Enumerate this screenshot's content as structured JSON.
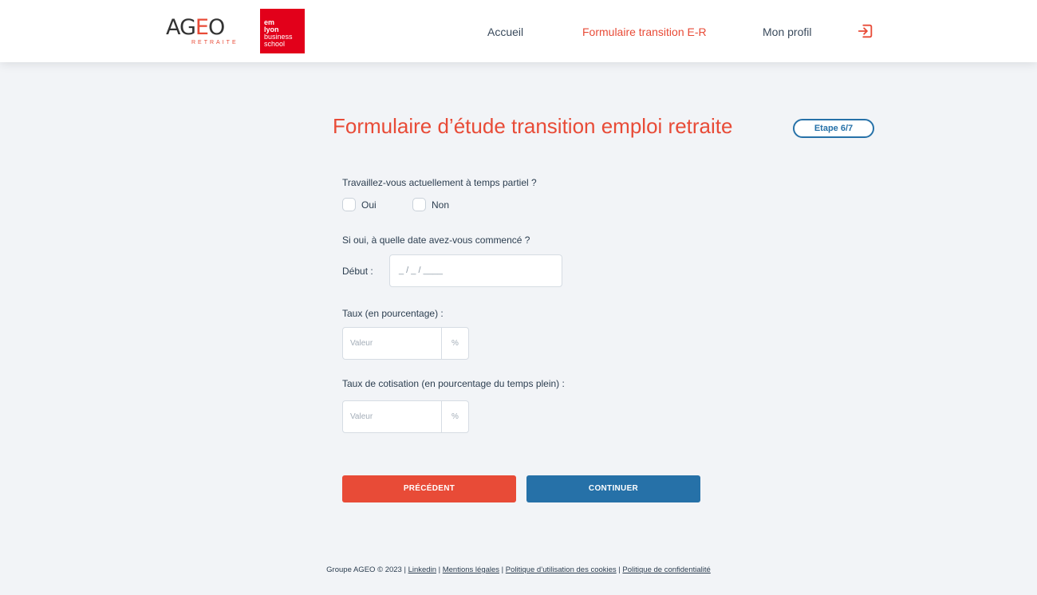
{
  "header": {
    "logo_ageo": {
      "word_main": "AG",
      "word_accent": "E",
      "word_end": "O",
      "subtitle": "RETRAITE"
    },
    "logo_em": {
      "line1": "em",
      "line2": "lyon",
      "line3": "business",
      "line4": "school"
    },
    "nav": [
      {
        "label": "Accueil",
        "active": false
      },
      {
        "label": "Formulaire transition E-R",
        "active": true
      },
      {
        "label": "Mon profil",
        "active": false
      }
    ],
    "logout_icon": "logout-icon"
  },
  "form": {
    "title": "Formulaire d’étude transition emploi retraite",
    "step": "Etape 6/7",
    "q1": {
      "label": "Travaillez-vous actuellement à temps partiel ?",
      "options": [
        {
          "label": "Oui",
          "checked": false
        },
        {
          "label": "Non",
          "checked": false
        }
      ]
    },
    "q2": {
      "label": "Si oui, à quelle date avez-vous commencé ?",
      "date_label": "Début :",
      "date_placeholder": "_ / _ / ____"
    },
    "q3": {
      "label": "Taux (en pourcentage) :",
      "placeholder": "Valeur",
      "suffix": "%"
    },
    "q4": {
      "label": "Taux de cotisation (en pourcentage du temps plein) :",
      "placeholder": "Valeur",
      "suffix": "%"
    },
    "buttons": {
      "prev": "PRÉCÉDENT",
      "next": "CONTINUER"
    }
  },
  "footer": {
    "copyright": "Groupe AGEO © 2023 | ",
    "links": [
      "Linkedin",
      "Mentions légales",
      "Politique d’utilisation des cookies",
      "Politique de confidentialité"
    ],
    "sep1": " | ",
    "sep2": " |  ",
    "sep3": " | "
  },
  "colors": {
    "accent": "#e84b37",
    "primary": "#2671a8",
    "background": "#f2f4f7"
  }
}
